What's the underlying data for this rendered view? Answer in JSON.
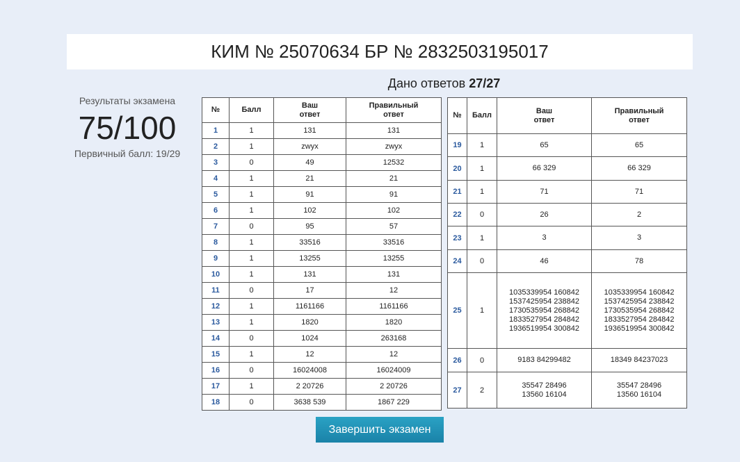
{
  "header": {
    "title": "КИМ № 25070634 БР № 2832503195017"
  },
  "answers_given": {
    "label": "Дано ответов",
    "value": "27/27"
  },
  "score": {
    "label": "Результаты экзамена",
    "value": "75/100",
    "primary": "Первичный балл: 19/29"
  },
  "table": {
    "headers": {
      "num": "№",
      "score": "Балл",
      "your": "Ваш\nответ",
      "correct": "Правильный\nответ"
    },
    "left_rows": [
      {
        "num": "1",
        "score": "1",
        "your": "131",
        "correct": "131"
      },
      {
        "num": "2",
        "score": "1",
        "your": "zwyx",
        "correct": "zwyx"
      },
      {
        "num": "3",
        "score": "0",
        "your": "49",
        "correct": "12532"
      },
      {
        "num": "4",
        "score": "1",
        "your": "21",
        "correct": "21"
      },
      {
        "num": "5",
        "score": "1",
        "your": "91",
        "correct": "91"
      },
      {
        "num": "6",
        "score": "1",
        "your": "102",
        "correct": "102"
      },
      {
        "num": "7",
        "score": "0",
        "your": "95",
        "correct": "57"
      },
      {
        "num": "8",
        "score": "1",
        "your": "33516",
        "correct": "33516"
      },
      {
        "num": "9",
        "score": "1",
        "your": "13255",
        "correct": "13255"
      },
      {
        "num": "10",
        "score": "1",
        "your": "131",
        "correct": "131"
      },
      {
        "num": "11",
        "score": "0",
        "your": "17",
        "correct": "12"
      },
      {
        "num": "12",
        "score": "1",
        "your": "1161166",
        "correct": "1161166"
      },
      {
        "num": "13",
        "score": "1",
        "your": "1820",
        "correct": "1820"
      },
      {
        "num": "14",
        "score": "0",
        "your": "1024",
        "correct": "263168"
      },
      {
        "num": "15",
        "score": "1",
        "your": "12",
        "correct": "12"
      },
      {
        "num": "16",
        "score": "0",
        "your": "16024008",
        "correct": "16024009"
      },
      {
        "num": "17",
        "score": "1",
        "your": "2 20726",
        "correct": "2 20726"
      },
      {
        "num": "18",
        "score": "0",
        "your": "3638 539",
        "correct": "1867 229"
      }
    ],
    "right_rows": [
      {
        "num": "19",
        "score": "1",
        "your": "65",
        "correct": "65"
      },
      {
        "num": "20",
        "score": "1",
        "your": "66 329",
        "correct": "66 329"
      },
      {
        "num": "21",
        "score": "1",
        "your": "71",
        "correct": "71"
      },
      {
        "num": "22",
        "score": "0",
        "your": "26",
        "correct": "2"
      },
      {
        "num": "23",
        "score": "1",
        "your": "3",
        "correct": "3"
      },
      {
        "num": "24",
        "score": "0",
        "your": "46",
        "correct": "78"
      },
      {
        "num": "25",
        "score": "1",
        "your": "1035339954 160842\n1537425954 238842\n1730535954 268842\n1833527954 284842\n1936519954 300842",
        "correct": "1035339954 160842\n1537425954 238842\n1730535954 268842\n1833527954 284842\n1936519954 300842"
      },
      {
        "num": "26",
        "score": "0",
        "your": "9183 84299482",
        "correct": "18349 84237023"
      },
      {
        "num": "27",
        "score": "2",
        "your": "35547 28496\n13560 16104",
        "correct": "35547 28496\n13560 16104"
      }
    ]
  },
  "actions": {
    "finish_label": "Завершить экзамен"
  },
  "colors": {
    "background": "#e8eef8",
    "button": "#1a82a8",
    "row_number": "#2b5a9e"
  }
}
